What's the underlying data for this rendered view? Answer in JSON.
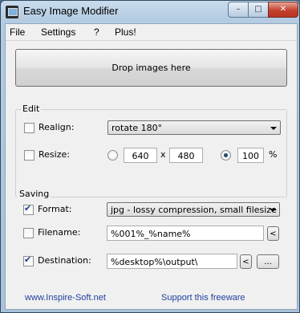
{
  "window": {
    "title": "Easy Image Modifier",
    "minimize": "–",
    "maximize": "□",
    "close": "✕"
  },
  "menu": [
    "File",
    "Settings",
    "?",
    "Plus!"
  ],
  "drop_label": "Drop images here",
  "edit": {
    "title": "Edit",
    "realign": {
      "label": "Realign:",
      "checked": false,
      "value": "rotate 180°"
    },
    "resize": {
      "label": "Resize:",
      "checked": false,
      "width": "640",
      "x_label": "x",
      "height": "480",
      "percent": "100",
      "percent_sign": "%"
    }
  },
  "saving": {
    "title": "Saving",
    "format": {
      "label": "Format:",
      "checked": true,
      "value": "jpg - lossy compression, small filesize"
    },
    "filename": {
      "label": "Filename:",
      "checked": false,
      "value": "%001%_%name%",
      "insert_button": "<"
    },
    "destination": {
      "label": "Destination:",
      "checked": true,
      "value": "%desktop%\\output\\",
      "insert_button": "<",
      "browse_button": "..."
    }
  },
  "footer": {
    "website": "www.Inspire-Soft.net",
    "support": "Support this freeware"
  }
}
